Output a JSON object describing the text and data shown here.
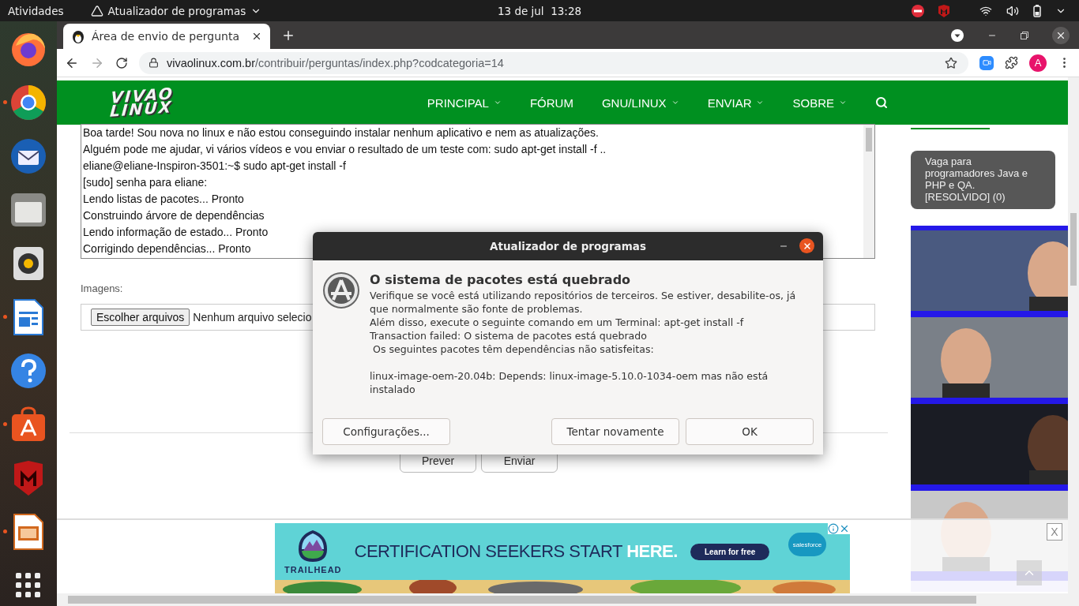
{
  "top_bar": {
    "activities": "Atividades",
    "app_menu": "Atualizador de programas",
    "clock": "13 de jul  13:28"
  },
  "dock": [
    {
      "kind": "firefox",
      "running": false
    },
    {
      "kind": "chrome",
      "running": true
    },
    {
      "kind": "mail",
      "running": false
    },
    {
      "kind": "files",
      "running": false
    },
    {
      "kind": "music",
      "running": false
    },
    {
      "kind": "writer",
      "running": true
    },
    {
      "kind": "help",
      "running": false
    },
    {
      "kind": "store",
      "running": true
    },
    {
      "kind": "shield",
      "running": false
    },
    {
      "kind": "impress",
      "running": true
    },
    {
      "kind": "grid",
      "running": false
    }
  ],
  "browser": {
    "tab_title": "Área de envio de pergunta",
    "url_host": "vivaolinux.com.br",
    "url_path": "/contribuir/perguntas/index.php?codcategoria=14",
    "profile_initial": "A"
  },
  "site": {
    "logo_top": "VIVAO",
    "logo_bottom": "LINUX",
    "nav": [
      {
        "label": "PRINCIPAL",
        "dropdown": true
      },
      {
        "label": "FÓRUM",
        "dropdown": false
      },
      {
        "label": "GNU/LINUX",
        "dropdown": true
      },
      {
        "label": "ENVIAR",
        "dropdown": true
      },
      {
        "label": "SOBRE",
        "dropdown": true
      }
    ]
  },
  "question_lines": [
    "Boa tarde! Sou nova no linux e não estou conseguindo instalar nenhum aplicativo e nem as atualizações.",
    "Alguém pode me ajudar, vi vários vídeos e vou enviar o resultado de um teste com: sudo apt-get install -f ..",
    "eliane@eliane-Inspiron-3501:~$ sudo apt-get install -f",
    "[sudo] senha para eliane:",
    "Lendo listas de pacotes... Pronto",
    "Construindo árvore de dependências",
    "Lendo informação de estado... Pronto",
    "Corrigindo dependências... Pronto"
  ],
  "images_label": "Imagens:",
  "file_button": "Escolher arquivos",
  "file_status": "Nenhum arquivo selecio",
  "form_buttons": [
    "Prever",
    "Enviar"
  ],
  "sidebar_card": "Vaga para programadores Java e PHP e QA. [RESOLVIDO] (0)",
  "bottom_ad": {
    "brand": "TRAILHEAD",
    "headline": "CERTIFICATION SEEKERS START",
    "highlight": "HERE.",
    "cta": "Learn for free",
    "sponsor": "salesforce",
    "close": "X"
  },
  "dialog": {
    "title": "Atualizador de programas",
    "heading": "O sistema de pacotes está quebrado",
    "body": [
      "Verifique se você está utilizando repositórios de terceiros. Se estiver, desabilite-os, já que normalmente são fonte de problemas.",
      "Além disso, execute o seguinte comando em um Terminal: apt-get install -f",
      "Transaction failed: O sistema de pacotes está quebrado",
      " Os seguintes pacotes têm dependências não satisfeitas:"
    ],
    "detail": "linux-image-oem-20.04b: Depends: linux-image-5.10.0-1034-oem mas não está instalado",
    "buttons": [
      {
        "label": "Configurações...",
        "kind": "left"
      },
      {
        "label": "Tentar novamente",
        "kind": "right"
      },
      {
        "label": "OK",
        "kind": "right"
      }
    ]
  }
}
